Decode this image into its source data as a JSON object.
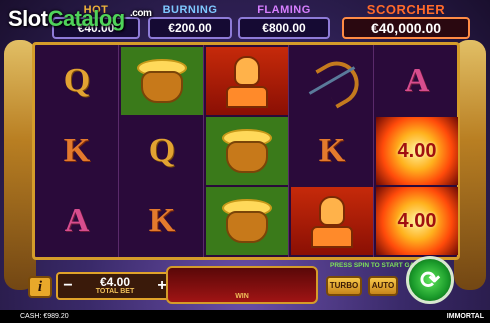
{
  "watermark": {
    "part1": "Slot",
    "part2": "Catalog",
    "com": ".com"
  },
  "jackpots": {
    "hot": {
      "title": "HOT",
      "value": "€40.00"
    },
    "burning": {
      "title": "BURNING",
      "value": "€200.00"
    },
    "flaming": {
      "title": "FLAMING",
      "value": "€800.00"
    },
    "scorcher": {
      "title": "SCORCHER",
      "value": "€40,000.00"
    }
  },
  "reels": [
    [
      "Q",
      "K",
      "A"
    ],
    [
      "pot",
      "Q",
      "K"
    ],
    [
      "warrior",
      "pot",
      "pot"
    ],
    [
      "bow",
      "K",
      "warrior"
    ],
    [
      "A",
      "4.00",
      "4.00"
    ]
  ],
  "fire_values": [
    "4.00",
    "4.00"
  ],
  "controls": {
    "info_label": "i",
    "bet_minus": "−",
    "bet_plus": "+",
    "bet_value": "€4.00",
    "bet_label": "TOTAL BET",
    "win_label": "WIN",
    "press_spin": "PRESS SPIN TO START GAME",
    "turbo_label": "TURBO",
    "auto_label": "AUTO",
    "spin_symbol": "⟳"
  },
  "status": {
    "cash_label": "CASH:",
    "cash_value": "€989.20",
    "brand": "IMMORTAL"
  }
}
